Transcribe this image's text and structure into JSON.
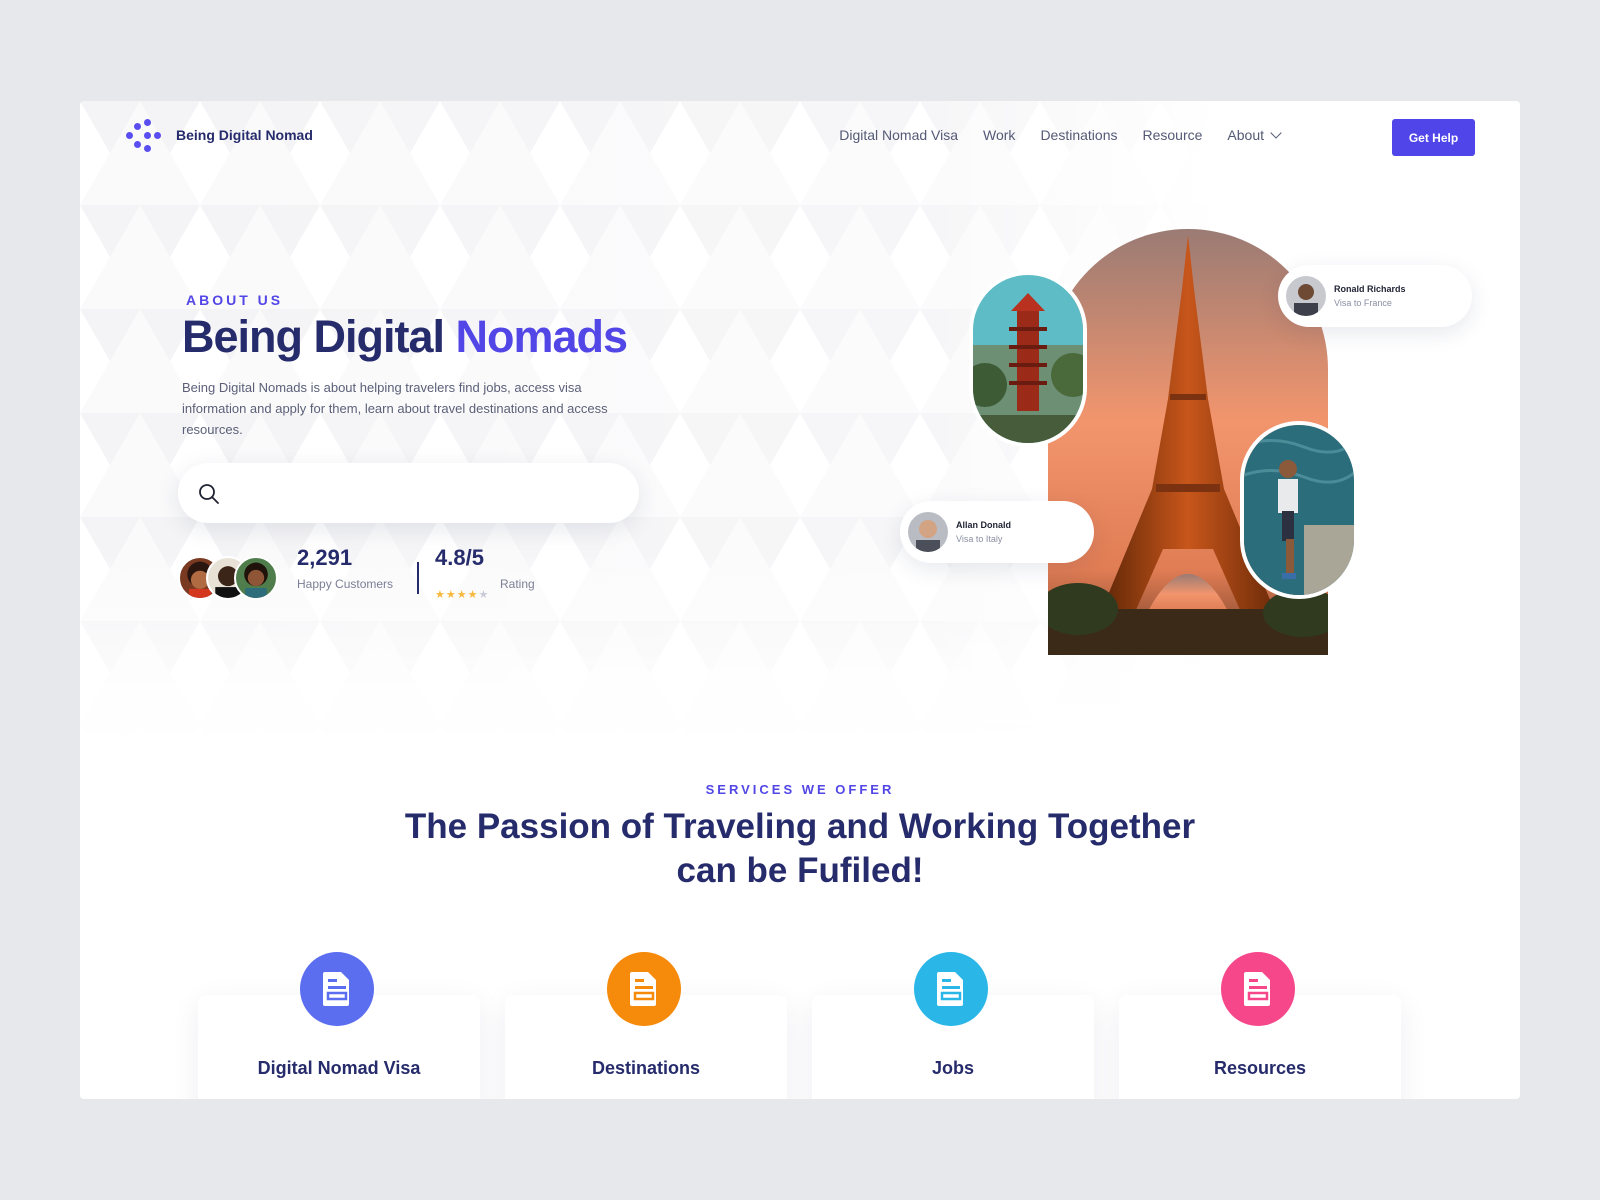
{
  "brand": {
    "name": "Being Digital Nomad"
  },
  "nav": {
    "items": [
      {
        "label": "Digital Nomad Visa"
      },
      {
        "label": "Work"
      },
      {
        "label": "Destinations"
      },
      {
        "label": "Resource"
      },
      {
        "label": "About",
        "has_dropdown": true
      }
    ],
    "cta_label": "Get Help"
  },
  "hero": {
    "eyebrow": "ABOUT US",
    "title_part1": "Being Digital",
    "title_part2": "Nomads",
    "description": "Being Digital Nomads is about helping travelers find jobs, access visa information and apply for them, learn about travel destinations and access resources.",
    "search": {
      "value": "",
      "placeholder": ""
    },
    "stats": {
      "customers_value": "2,291",
      "customers_label": "Happy Customers",
      "rating_value": "4.8/5",
      "rating_label": "Rating",
      "stars_filled": 4,
      "stars_total": 5
    }
  },
  "collage": {
    "cards": [
      {
        "name": "Ronald Richards",
        "subtitle": "Visa to France"
      },
      {
        "name": "Allan Donald",
        "subtitle": "Visa to Italy"
      }
    ]
  },
  "services": {
    "eyebrow": "SERVICES WE OFFER",
    "title_line1": "The Passion of Traveling and Working Together",
    "title_line2": "can be Fufiled!",
    "items": [
      {
        "label": "Digital Nomad Visa",
        "color": "#5b6ef0",
        "icon": "document-icon"
      },
      {
        "label": "Destinations",
        "color": "#f58a0b",
        "icon": "document-icon"
      },
      {
        "label": "Jobs",
        "color": "#2ab7e8",
        "icon": "document-icon"
      },
      {
        "label": "Resources",
        "color": "#f7478b",
        "icon": "document-icon"
      }
    ]
  },
  "colors": {
    "primary": "#4f45e8",
    "heading": "#262b6b",
    "page_background": "#e6e8ec"
  }
}
